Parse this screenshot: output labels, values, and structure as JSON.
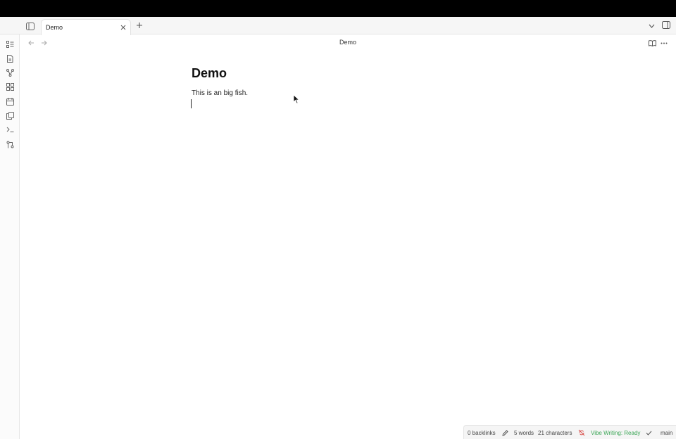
{
  "tabs": [
    {
      "title": "Demo"
    }
  ],
  "header": {
    "title": "Demo"
  },
  "note": {
    "title": "Demo",
    "body": "This is an big fish."
  },
  "ribbon": {
    "icons": [
      "outline-icon",
      "file-icon",
      "graph-icon",
      "grid-icon",
      "calendar-icon",
      "copy-icon",
      "terminal-icon",
      "git-icon"
    ]
  },
  "status": {
    "backlinks": "0 backlinks",
    "words": "5 words",
    "characters": "21 characters",
    "vibe": "Vibe Writing: Ready",
    "branch": "main",
    "vibe_color": "#3aa655"
  }
}
